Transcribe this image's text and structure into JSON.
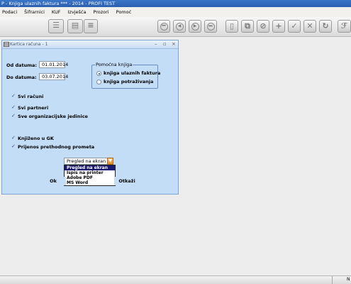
{
  "app": {
    "title": "P - Knjiga ulaznih faktura *** - 2014 - PROFI TEST"
  },
  "menu": [
    "Podaci",
    "Šifrarnici",
    "KUF",
    "Izvješća",
    "Prozori",
    "Pomoć"
  ],
  "toolbar": {
    "icons": [
      "report-icon",
      "print-preview-icon",
      "database-icon",
      "first-record-icon",
      "previous-record-icon",
      "next-record-icon",
      "last-record-icon",
      "new-document-icon",
      "copy-document-icon",
      "cancel-icon",
      "add-icon",
      "confirm-icon",
      "delete-icon",
      "refresh-icon",
      "filter-icon"
    ]
  },
  "window": {
    "title": "Kartica računa - 1",
    "min_glyph": "–",
    "max_glyph": "▫",
    "close_glyph": "×",
    "od_datuma_label": "Od datuma:",
    "od_datuma_value": "01.01.2014",
    "do_datuma_label": "Do datuma:",
    "do_datuma_value": "03.07.2014",
    "group_title": "Pomoćna knjiga",
    "radio_options": [
      {
        "label": "knjiga ulaznih faktura",
        "selected": true
      },
      {
        "label": "knjiga potraživanja",
        "selected": false
      }
    ],
    "checkboxes": [
      {
        "label": "Svi računi",
        "checked": true
      },
      {
        "label": "Svi partneri",
        "checked": true
      },
      {
        "label": "Sve organizacijske jedinice",
        "checked": true
      },
      {
        "label": "Knjiženo u GK",
        "checked": true
      },
      {
        "label": "Prijenos prethodnog prometa",
        "checked": true
      }
    ],
    "output_select": {
      "value": "Pregled na ekran",
      "options": [
        "Pregled na ekran",
        "Ispis na printer",
        "Adobe PDF",
        "MS Word"
      ]
    },
    "ok_label": "Ok",
    "cancel_label": "Otkaži"
  },
  "status": {
    "right_text": "N"
  }
}
